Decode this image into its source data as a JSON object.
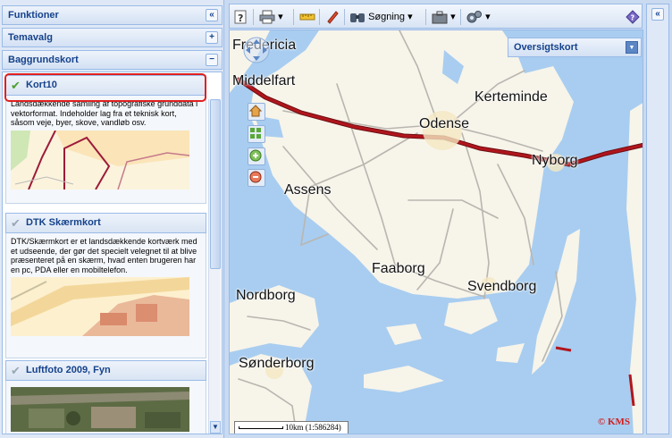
{
  "left_panel": {
    "funktioner": "Funktioner",
    "temavalg": "Temavalg",
    "baggrundskort": "Baggrundskort",
    "collapse_glyph": "«",
    "expand_glyph": "+",
    "minus_glyph": "−",
    "layers": [
      {
        "title": "Kort10",
        "checked": true,
        "description": "Landsdækkende samling af topografiske grunddata i vektorformat. Indeholder lag fra et teknisk kort, såsom veje, byer, skove, vandløb osv."
      },
      {
        "title": "DTK Skærmkort",
        "checked": false,
        "description": "DTK/Skærmkort er et landsdækkende kortværk med et udseende, der gør det specielt velegnet til at blive præsenteret på en skærm, hvad enten brugeren har en pc, PDA eller en mobiltelefon."
      },
      {
        "title": "Luftfoto 2009, Fyn",
        "checked": false,
        "description": ""
      }
    ]
  },
  "toolbar": {
    "search_label": "Søgning",
    "dropdown_glyph": "▾"
  },
  "map": {
    "overview_label": "Oversigtskort",
    "scale_text": "10km (1:586284)",
    "copyright": "© KMS",
    "places": {
      "fredericia": "Fredericia",
      "middelfart": "Middelfart",
      "kerteminde": "Kerteminde",
      "odense": "Odense",
      "nyborg": "Nyborg",
      "assens": "Assens",
      "faaborg": "Faaborg",
      "svendborg": "Svendborg",
      "nordborg": "Nordborg",
      "sonderborg": "Sønderborg"
    },
    "land_color": "#f7f4ea",
    "water_color": "#a8cdf0",
    "motorway_color": "#b1151c"
  },
  "right_panel": {
    "collapse_glyph": "«"
  }
}
